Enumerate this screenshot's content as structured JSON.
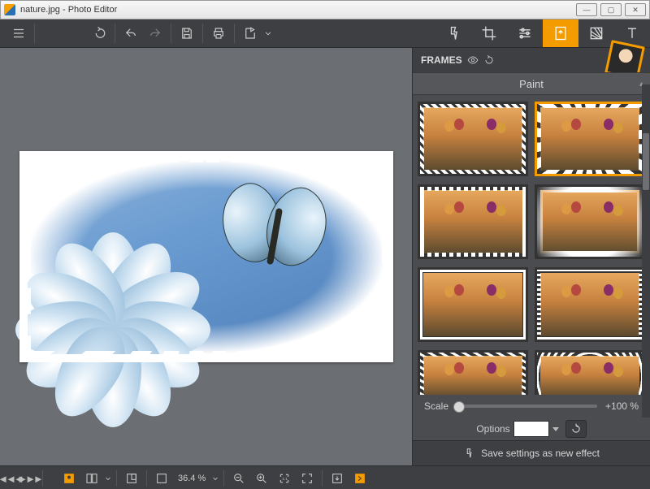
{
  "title": "nature.jpg - Photo Editor",
  "panel": {
    "header": "FRAMES",
    "category": "Paint"
  },
  "controls": {
    "scale_label": "Scale",
    "scale_value": "+100 %",
    "options_label": "Options",
    "save_effect": "Save settings as new effect"
  },
  "bottom": {
    "zoom": "36.4 %"
  },
  "frames": {
    "selected_index": 1,
    "items": [
      0,
      1,
      2,
      3,
      4,
      5,
      6,
      7
    ]
  }
}
